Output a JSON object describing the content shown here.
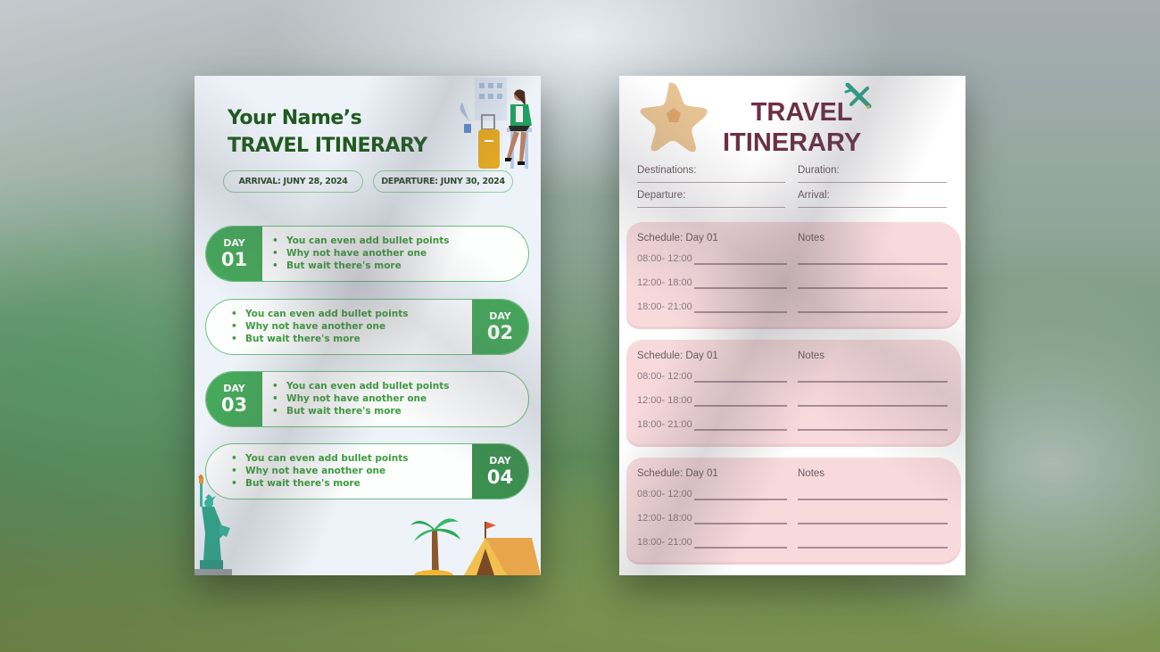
{
  "left_page": {
    "title_line1": "Your Name’s",
    "title_line2": "TRAVEL ITINERARY",
    "arrival": "ARRIVAL: JUNY 28, 2024",
    "departure": "DEPARTURE: JUNY 30, 2024",
    "days": [
      {
        "label": "DAY",
        "number": "01",
        "side": "left",
        "bullets": [
          "You can even add bullet points",
          "Why not have another one",
          "But wait there's more"
        ]
      },
      {
        "label": "DAY",
        "number": "02",
        "side": "right",
        "bullets": [
          "You can even add bullet points",
          "Why not have another one",
          "But wait there's more"
        ]
      },
      {
        "label": "DAY",
        "number": "03",
        "side": "left",
        "bullets": [
          "You can even add bullet points",
          "Why not have another one",
          "But wait there's more"
        ]
      },
      {
        "label": "DAY",
        "number": "04",
        "side": "right",
        "bullets": [
          "You can even add bullet points",
          "Why not have another one",
          "But wait there's more"
        ]
      }
    ],
    "colors": {
      "title": "#1f5a1f",
      "accent": "#45a85a",
      "bullet_text": "#3d9e3d"
    },
    "illustrations": [
      "traveler-woman-with-suitcase-icon",
      "statue-of-liberty-icon",
      "palm-tree-icon",
      "tent-icon"
    ]
  },
  "right_page": {
    "title_line1": "TRAVEL",
    "title_line2": "ITINERARY",
    "fields": {
      "destinations": "Destinations:",
      "duration": "Duration:",
      "departure": "Departure:",
      "arrival": "Arrival:"
    },
    "schedules": [
      {
        "heading": "Schedule: Day 01",
        "notes": "Notes",
        "times": [
          "08:00- 12:00",
          "12:00- 18:00",
          "18:00- 21:00"
        ]
      },
      {
        "heading": "Schedule: Day 01",
        "notes": "Notes",
        "times": [
          "08:00- 12:00",
          "12:00- 18:00",
          "18:00- 21:00"
        ]
      },
      {
        "heading": "Schedule: Day 01",
        "notes": "Notes",
        "times": [
          "08:00- 12:00",
          "12:00- 18:00",
          "18:00- 21:00"
        ]
      }
    ],
    "colors": {
      "title": "#6b2f43",
      "schedule_bg": "#f8dadd"
    },
    "illustrations": [
      "star-icon",
      "airplane-icon"
    ]
  }
}
